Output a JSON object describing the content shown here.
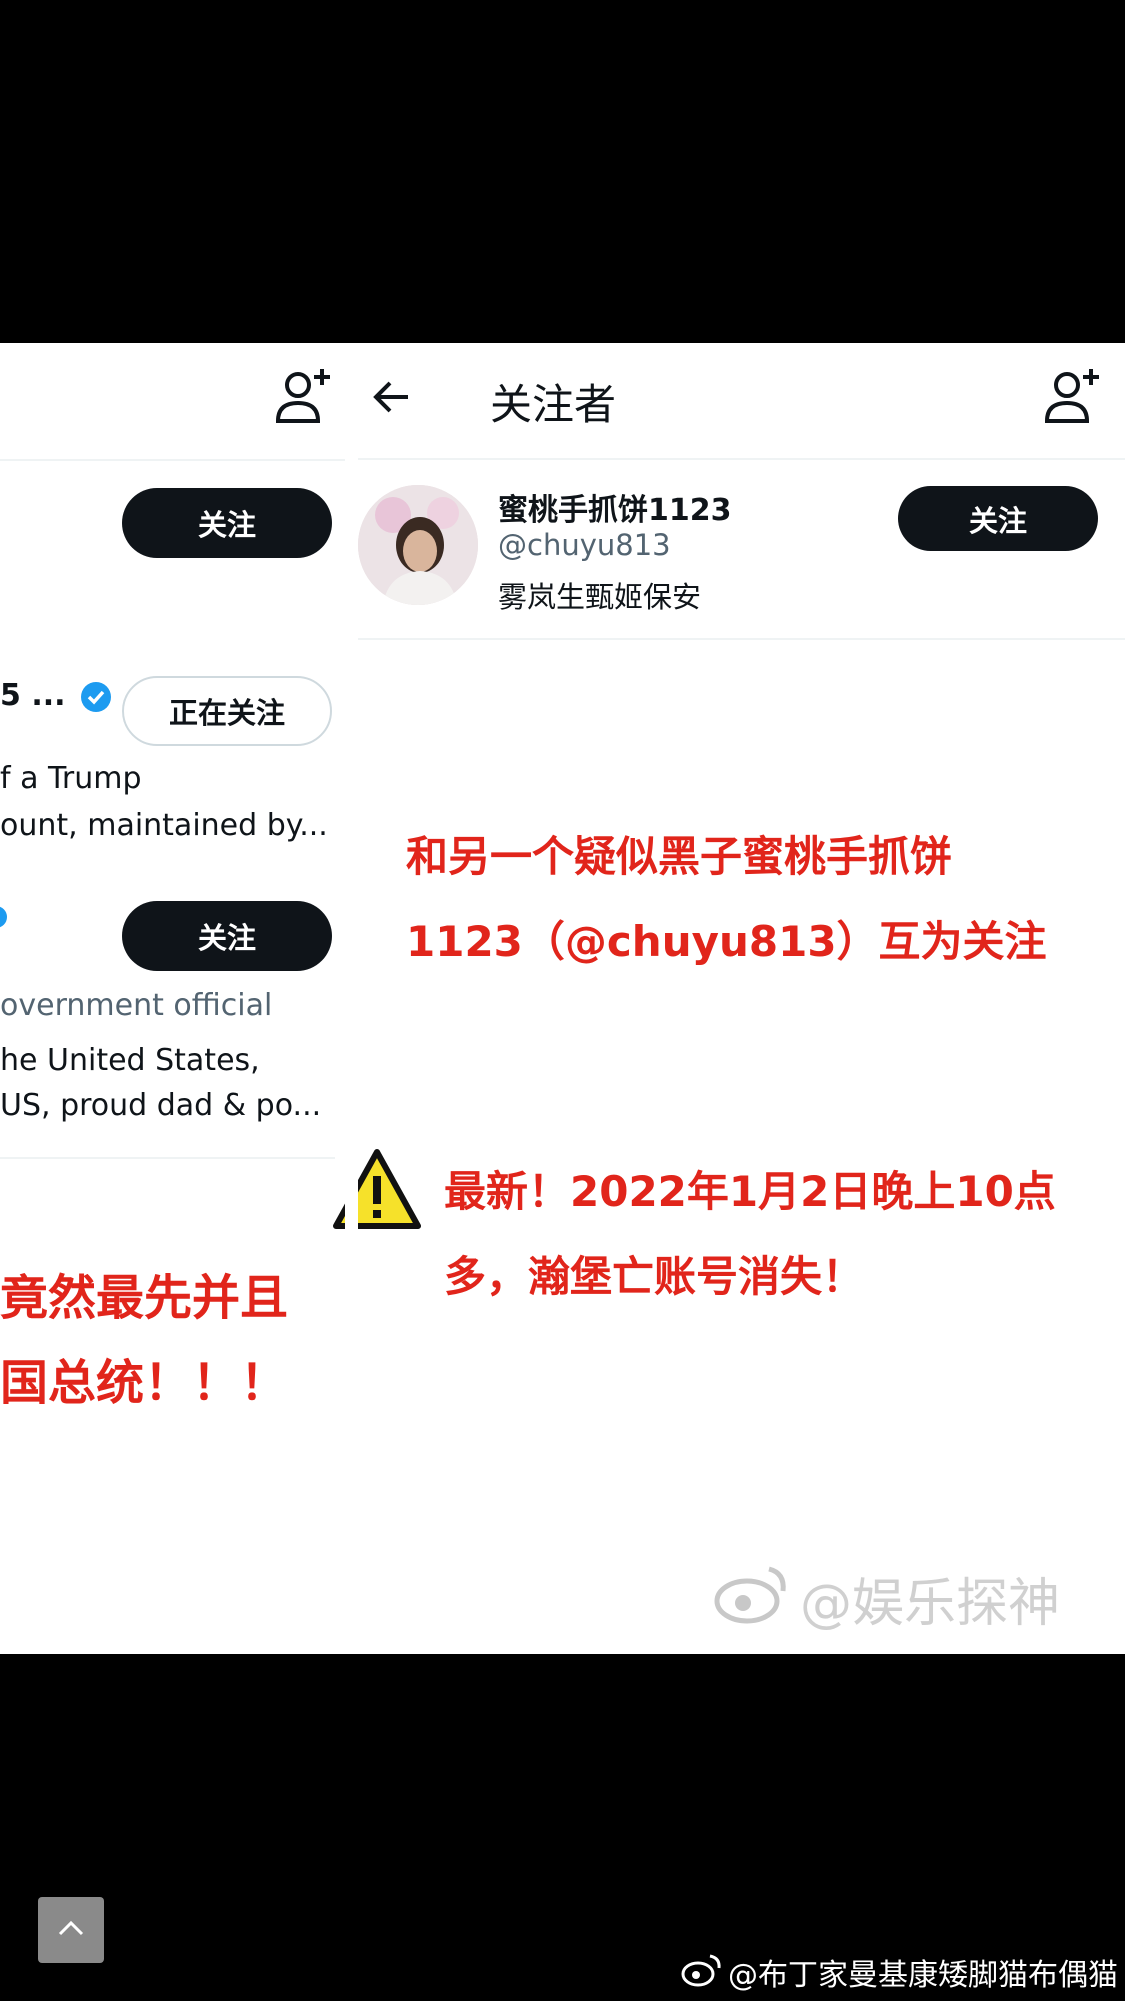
{
  "left_panel": {
    "follow_btn_1": "关注",
    "name_partial": "5 ...",
    "following_btn": "正在关注",
    "bio_line_1": "f a Trump",
    "bio_line_2": "ount, maintained by...",
    "follow_btn_2": "关注",
    "role": "overnment official",
    "bio2_line_1": "he United States,",
    "bio2_line_2": "US, proud dad & po...",
    "red_line_1": "竟然最先并且",
    "red_line_2": "国总统！！！"
  },
  "right_panel": {
    "header_title": "关注者",
    "user": {
      "display_name": "蜜桃手抓饼1123",
      "handle": "@chuyu813",
      "bio": "雾岚生甄姬保安",
      "follow_btn": "关注"
    },
    "red_annotation_line_1": "和另一个疑似黑子蜜桃手抓饼",
    "red_annotation_line_2": "1123（@chuyu813）互为关注",
    "warning_line_1": "最新！2022年1月2日晚上10点",
    "warning_line_2": "多，瀚堡亡账号消失！"
  },
  "watermark": "@娱乐探神",
  "footer": {
    "author_credit": "@布丁家曼基康矮脚猫布偶猫"
  },
  "icons": [
    "add-user-icon",
    "back-arrow-icon",
    "verified-badge-icon",
    "warning-icon",
    "weibo-logo-icon",
    "chevron-up-icon"
  ],
  "colors": {
    "annotation_red": "#e1251b",
    "button_black": "#0f1419",
    "verified_blue": "#1d9bf0"
  }
}
